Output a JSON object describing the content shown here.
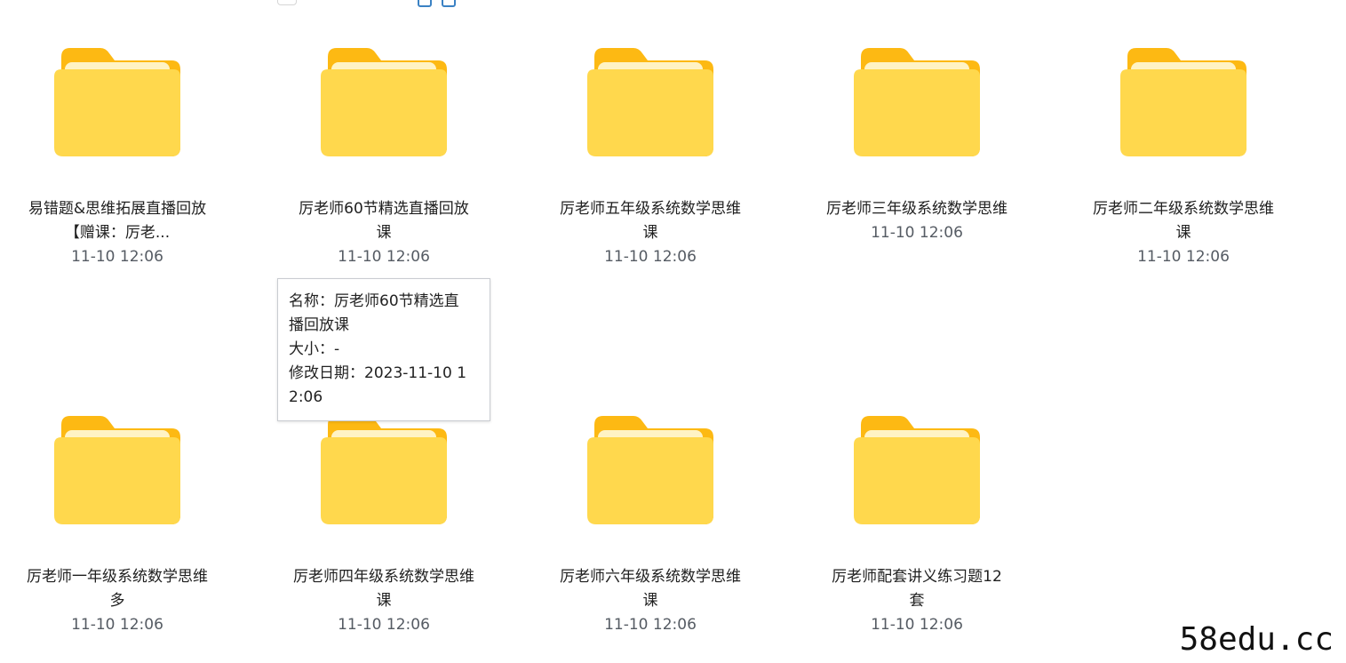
{
  "folders": [
    {
      "name_line1": "易错题&思维拓展直播回放",
      "name_line2": "【赠课：厉老...",
      "date": "11-10 12:06"
    },
    {
      "name_line1": "厉老师60节精选直播回放",
      "name_line2": "课",
      "date": "11-10 12:06"
    },
    {
      "name_line1": "厉老师五年级系统数学思维",
      "name_line2": "课",
      "date": "11-10 12:06"
    },
    {
      "name_line1": "厉老师三年级系统数学思维",
      "name_line2": "",
      "date": "11-10 12:06"
    },
    {
      "name_line1": "厉老师二年级系统数学思维",
      "name_line2": "课",
      "date": "11-10 12:06"
    },
    {
      "name_line1": "厉老师一年级系统数学思维",
      "name_line2": "多",
      "date": "11-10 12:06"
    },
    {
      "name_line1": "厉老师四年级系统数学思维",
      "name_line2": "课",
      "date": "11-10 12:06"
    },
    {
      "name_line1": "厉老师六年级系统数学思维",
      "name_line2": "课",
      "date": "11-10 12:06"
    },
    {
      "name_line1": "厉老师配套讲义练习题12",
      "name_line2": "套",
      "date": "11-10 12:06"
    }
  ],
  "tooltip": {
    "line1": "名称：厉老师60节精选直",
    "line2": "播回放课",
    "line3": "大小：-",
    "line4": "修改日期：2023-11-10 1",
    "line5": "2:06"
  },
  "watermark": "58edu.cc",
  "colors": {
    "folder_back": "#FDB913",
    "folder_front": "#FFD84D",
    "folder_paper": "#FFF3C4"
  }
}
